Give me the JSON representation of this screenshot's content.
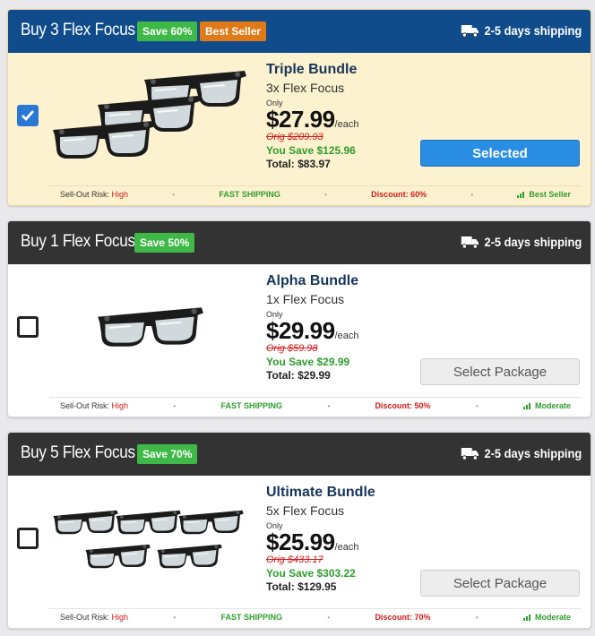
{
  "colors": {
    "selected_header": "#104c8c",
    "header": "#333333",
    "save_badge": "#3eb846",
    "best_badge": "#e07a19",
    "selected_bg": "#fdf2cf",
    "primary_button": "#2a8de4",
    "price_red": "#d11a1a",
    "save_green": "#2e9d2e"
  },
  "packages": [
    {
      "title": "Buy 3 Flex Focus",
      "save_badge": "Save 60%",
      "best_badge": "Best Seller",
      "shipping": "2-5 days shipping",
      "selected": true,
      "bundle_name": "Triple Bundle",
      "quantity": "3x Flex Focus",
      "only": "Only",
      "price": "$27.99",
      "each": "/each",
      "orig": "Orig $209.93",
      "you_save": "You Save $125.96",
      "total": "Total: $83.97",
      "button": "Selected",
      "footer": {
        "risk_label": "Sell-Out Risk:",
        "risk_value": "High",
        "fast": "FAST SHIPPING",
        "discount": "Discount: 60%",
        "popularity": "Best Seller"
      },
      "glasses_count": 3
    },
    {
      "title": "Buy 1 Flex Focus",
      "save_badge": "Save 50%",
      "shipping": "2-5 days shipping",
      "selected": false,
      "bundle_name": "Alpha Bundle",
      "quantity": "1x Flex Focus",
      "only": "Only",
      "price": "$29.99",
      "each": "/each",
      "orig": "Orig $59.98",
      "you_save": "You Save $29.99",
      "total": "Total: $29.99",
      "button": "Select Package",
      "footer": {
        "risk_label": "Sell-Out Risk:",
        "risk_value": "High",
        "fast": "FAST SHIPPING",
        "discount": "Discount: 50%",
        "popularity": "Moderate"
      },
      "glasses_count": 1
    },
    {
      "title": "Buy 5 Flex Focus",
      "save_badge": "Save 70%",
      "shipping": "2-5 days shipping",
      "selected": false,
      "bundle_name": "Ultimate Bundle",
      "quantity": "5x Flex Focus",
      "only": "Only",
      "price": "$25.99",
      "each": "/each",
      "orig": "Orig $433.17",
      "you_save": "You Save $303.22",
      "total": "Total: $129.95",
      "button": "Select Package",
      "footer": {
        "risk_label": "Sell-Out Risk:",
        "risk_value": "High",
        "fast": "FAST SHIPPING",
        "discount": "Discount: 70%",
        "popularity": "Moderate"
      },
      "glasses_count": 5
    }
  ],
  "icons": {
    "truck": "truck-icon",
    "check": "checkmark-icon",
    "signal": "signal-bars-icon",
    "product": "adjustable-glasses-image"
  }
}
